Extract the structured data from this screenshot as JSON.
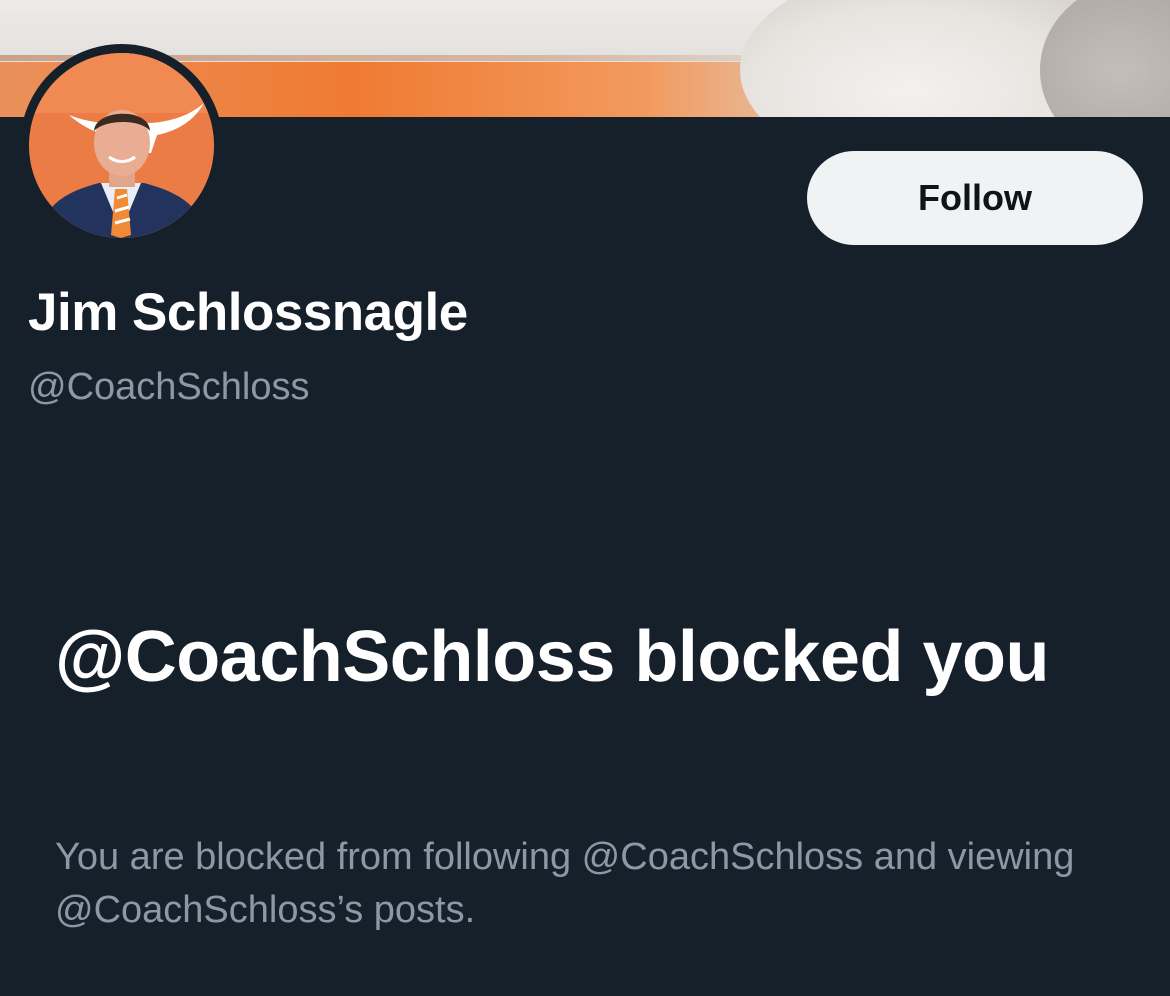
{
  "profile": {
    "display_name": "Jim Schlossnagle",
    "handle": "@CoachSchloss"
  },
  "actions": {
    "follow_label": "Follow"
  },
  "block_notice": {
    "title": "@CoachSchloss blocked you",
    "description": "You are blocked from following @CoachSchloss and viewing @CoachSchloss’s posts."
  },
  "theme": {
    "background": "#16202b",
    "primary_text": "#ffffff",
    "secondary_text": "#8b98a5",
    "button_bg": "#eff3f4",
    "brand_orange": "#f07a32"
  }
}
